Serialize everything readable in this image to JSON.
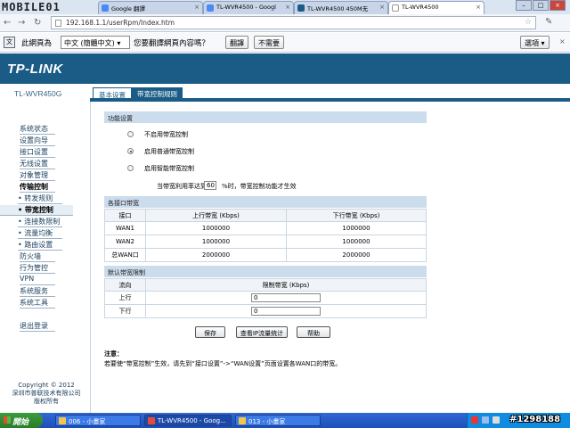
{
  "browser": {
    "tabs": [
      {
        "label": "Google 翻譯",
        "active": false
      },
      {
        "label": "TL-WVR4500 - Googl",
        "active": false
      },
      {
        "label": "TL-WVR4500 450M无",
        "active": false
      },
      {
        "label": "TL-WVR4500",
        "active": true
      }
    ],
    "logo_text": "MOBILE01",
    "address": "192.168.1.1/userRpm/Index.htm",
    "translate_bar": {
      "prefix": "此網頁為",
      "language": "中文 (簡體中文)",
      "question": "您要翻譯網頁內容嗎？",
      "translate_button": "翻譯",
      "decline_button": "不需要",
      "options_button": "選項"
    }
  },
  "router": {
    "brand": "TP-LINK",
    "model": "TL-WVR450G",
    "subtabs": [
      "基本设置",
      "带宽控制规则"
    ],
    "sidebar": {
      "items": [
        {
          "label": "系统状态",
          "bold": false,
          "sub": false
        },
        {
          "label": "设置向导",
          "bold": false,
          "sub": false
        },
        {
          "label": "接口设置",
          "bold": false,
          "sub": false
        },
        {
          "label": "无线设置",
          "bold": false,
          "sub": false
        },
        {
          "label": "对象管理",
          "bold": false,
          "sub": false
        },
        {
          "label": "传输控制",
          "bold": true,
          "sub": false
        },
        {
          "label": "• 转发规则",
          "bold": false,
          "sub": true
        },
        {
          "label": "• 带宽控制",
          "bold": true,
          "sub": true,
          "active": true
        },
        {
          "label": "• 连接数限制",
          "bold": false,
          "sub": true
        },
        {
          "label": "• 流量均衡",
          "bold": false,
          "sub": true
        },
        {
          "label": "• 路由设置",
          "bold": false,
          "sub": true
        },
        {
          "label": "防火墙",
          "bold": false,
          "sub": false
        },
        {
          "label": "行为管控",
          "bold": false,
          "sub": false
        },
        {
          "label": "VPN",
          "bold": false,
          "sub": false
        },
        {
          "label": "系统服务",
          "bold": false,
          "sub": false
        },
        {
          "label": "系统工具",
          "bold": false,
          "sub": false
        },
        {
          "label": "退出登录",
          "bold": false,
          "sub": false
        }
      ],
      "copyright_1": "Copyright © 2012",
      "copyright_2": "深圳市普联技术有限公司",
      "copyright_3": "版权所有"
    },
    "function_settings": {
      "header": "功能设置",
      "options": [
        "不启用带宽控制",
        "启用普通带宽控制",
        "启用智能带宽控制"
      ],
      "selected": 1,
      "threshold_prefix": "当带宽利用率达到",
      "threshold_value": "60",
      "threshold_suffix": "%时，带宽控制功能才生效"
    },
    "interface_bandwidth": {
      "header": "各接口带宽",
      "columns": [
        "接口",
        "上行带宽 (Kbps)",
        "下行带宽 (Kbps)"
      ],
      "rows": [
        [
          "WAN1",
          "1000000",
          "1000000"
        ],
        [
          "WAN2",
          "1000000",
          "1000000"
        ],
        [
          "总WAN口",
          "2000000",
          "2000000"
        ]
      ]
    },
    "default_limit": {
      "header": "默认带宽限制",
      "columns": [
        "流向",
        "限制带宽 (Kbps)"
      ],
      "rows": [
        {
          "dir": "上行",
          "value": "0"
        },
        {
          "dir": "下行",
          "value": "0"
        }
      ]
    },
    "buttons": {
      "save": "保存",
      "view_stats": "查看IP流量统计",
      "help": "帮助"
    },
    "note_title": "注意：",
    "note_text": "若要使“带宽控制”生效，请先到“接口设置”->“WAN设置”页面设置各WAN口的带宽。"
  },
  "taskbar": {
    "start": "開始",
    "tasks": [
      {
        "label": "006 - 小畫家",
        "active": false
      },
      {
        "label": "TL-WVR4500 - Goog...",
        "active": true
      },
      {
        "label": "013 - 小畫家",
        "active": false
      }
    ]
  },
  "watermark": "#1298188"
}
